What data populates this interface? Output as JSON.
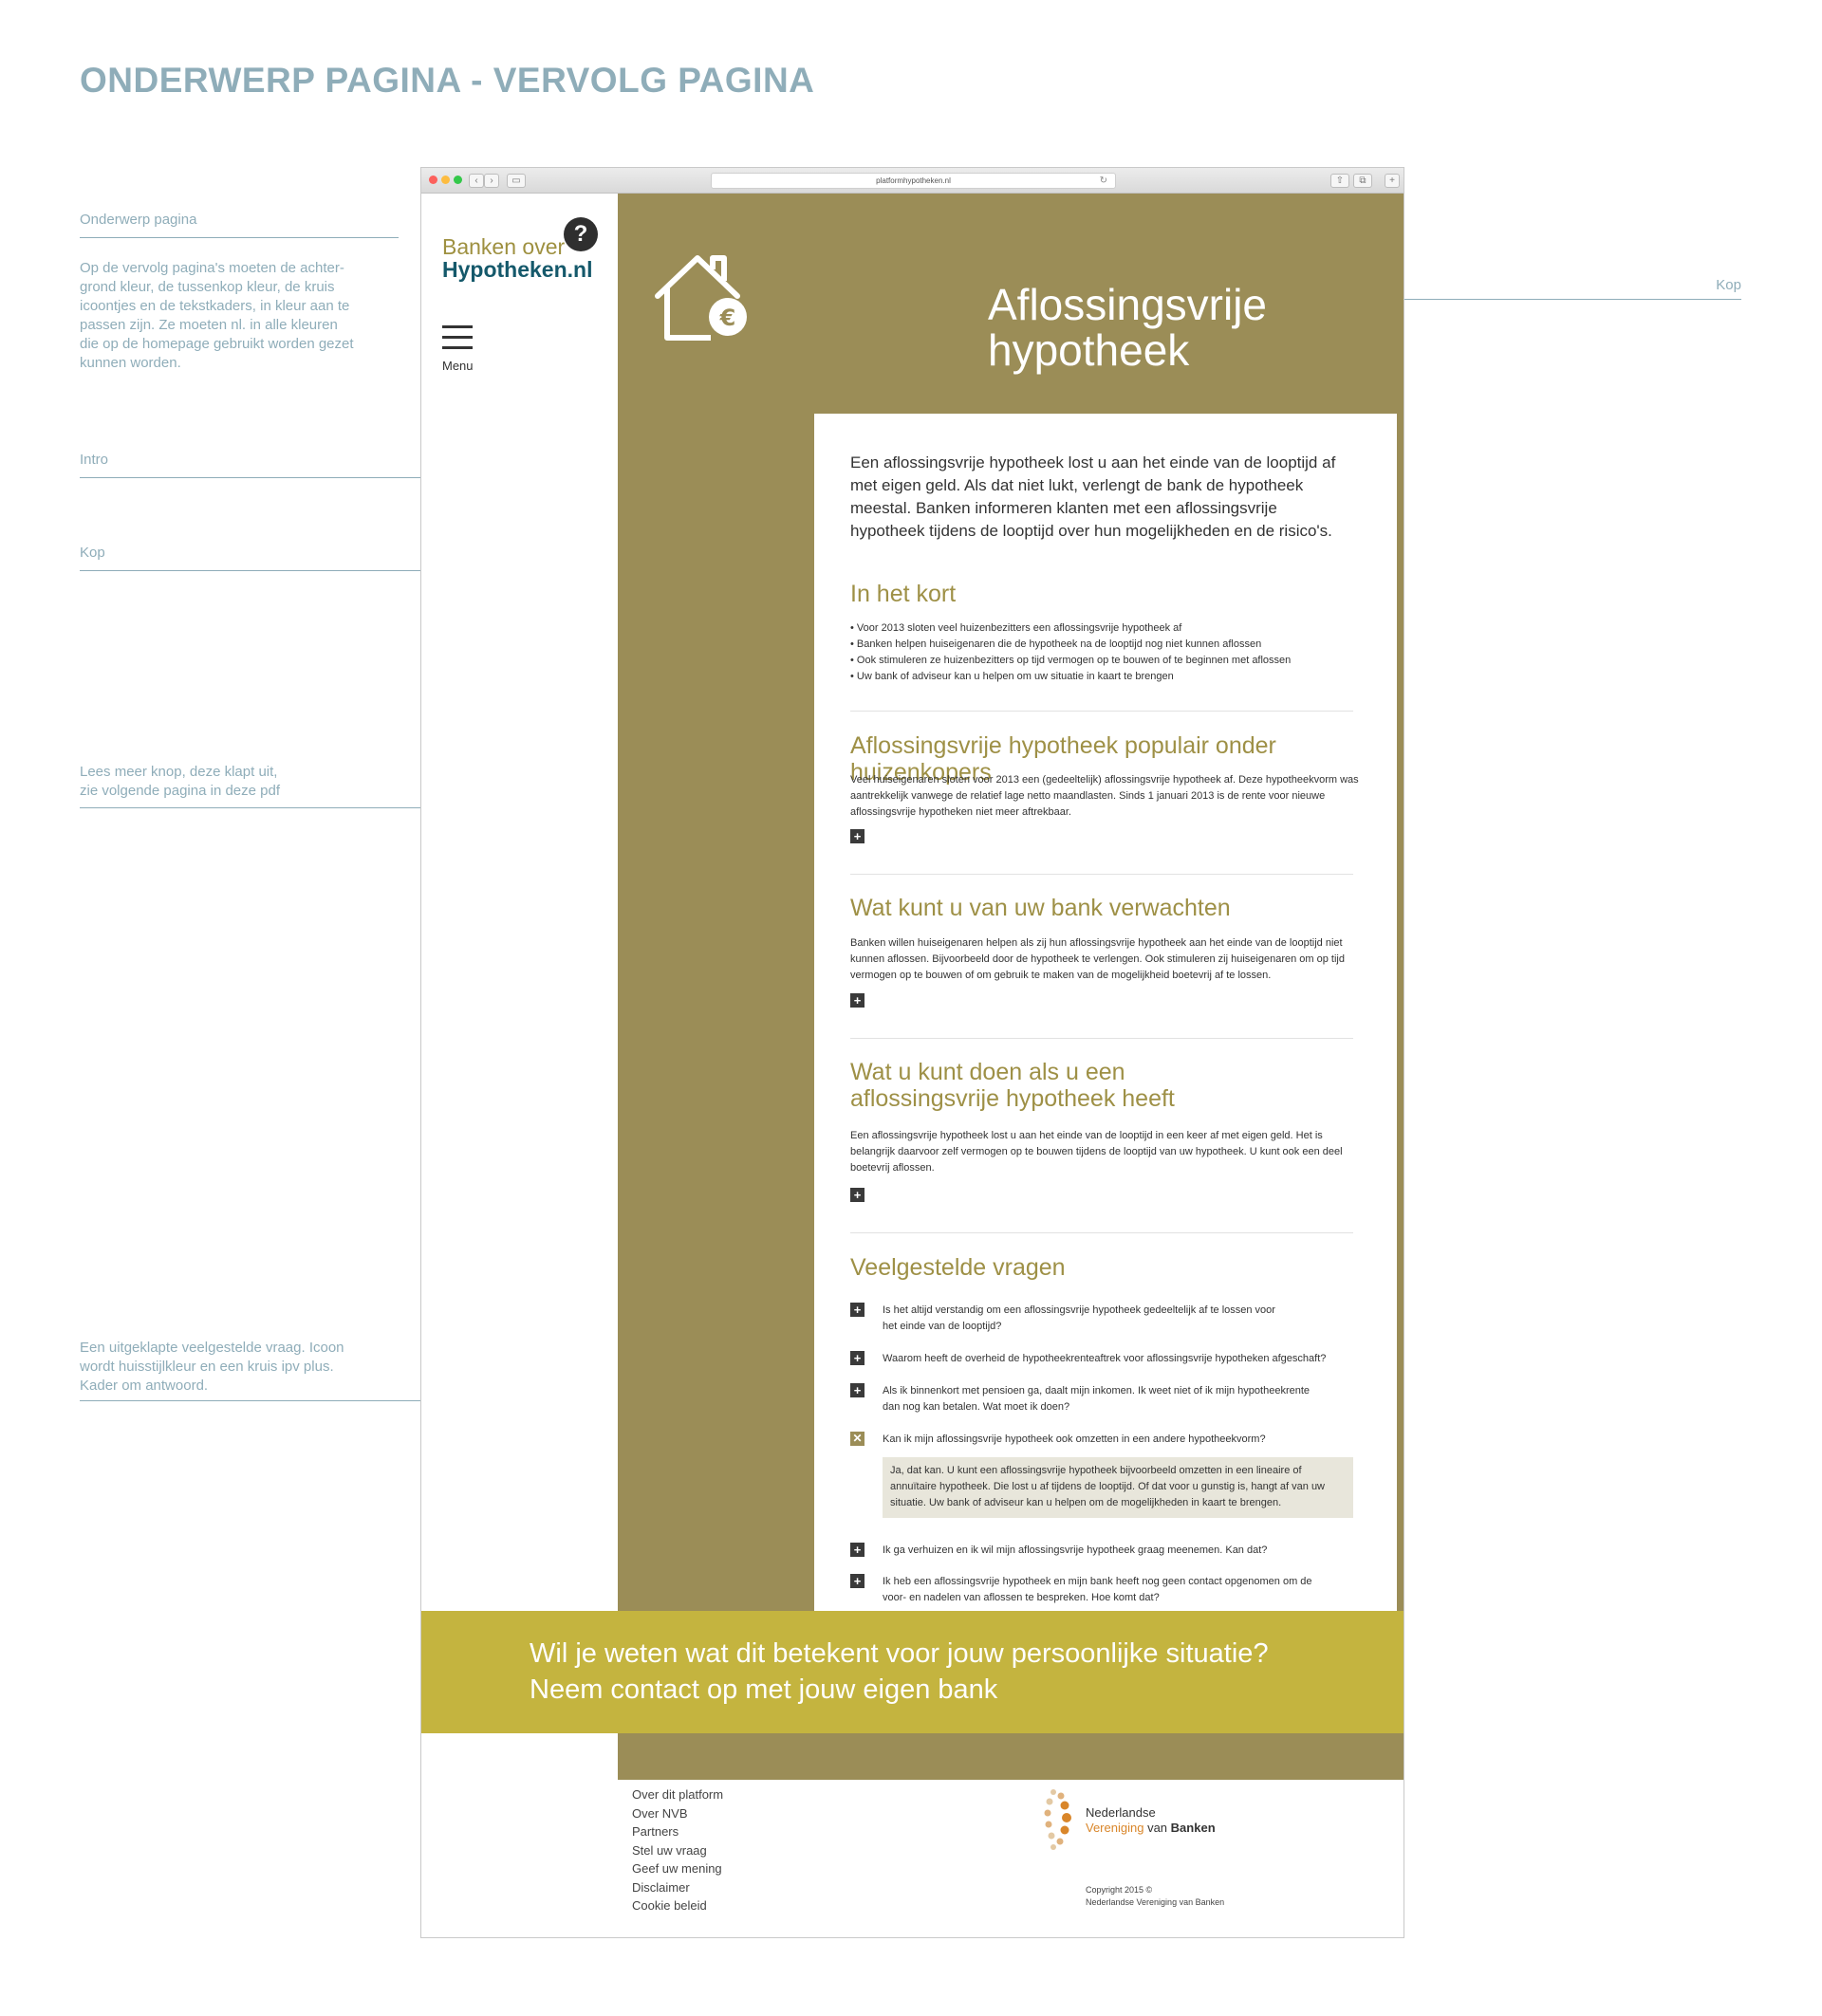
{
  "page_heading": "ONDERWERP PAGINA - VERVOLG PAGINA",
  "annotations": {
    "onderwerp_title": "Onderwerp pagina",
    "onderwerp_body": "Op de vervolg pagina's moeten de achter-grond kleur, de tussenkop kleur, de kruis icoontjes en de tekstkaders, in kleur aan te passen zijn. Ze moeten nl. in alle kleuren die op de homepage gebruikt worden gezet kunnen worden.",
    "intro": "Intro",
    "kop_left": "Kop",
    "kop_right": "Kop",
    "lees_meer": "Lees meer knop, deze klapt uit, zie volgende pagina in deze pdf",
    "faq_note": "Een uitgeklapte veelgestelde vraag. Icoon wordt huisstijlkleur en een kruis ipv plus. Kader om antwoord."
  },
  "browser": {
    "url": "platformhypotheken.nl"
  },
  "logo": {
    "line1": "Banken over",
    "line2": "Hypotheken.nl",
    "bubble": "?"
  },
  "menu_label": "Menu",
  "hero": {
    "title_line1": "Aflossingsvrije",
    "title_line2": "hypotheek"
  },
  "intro_text": "Een aflossingsvrije hypotheek lost u aan het einde van de looptijd af met eigen geld. Als dat niet lukt, verlengt de bank de hypotheek meestal. Banken informeren klanten met een aflossingsvrije hypotheek tijdens de looptijd over hun mogelijkheden en de risico's.",
  "kort": {
    "heading": "In het kort",
    "bullets": [
      "• Voor 2013 sloten veel huizenbezitters een aflossingsvrije hypotheek af",
      "• Banken helpen huiseigenaren die de hypotheek na de looptijd nog niet kunnen aflossen",
      "• Ook stimuleren ze huizenbezitters op tijd vermogen op te bouwen of te beginnen met aflossen",
      "• Uw bank of adviseur kan u helpen om uw situatie in kaart te brengen"
    ]
  },
  "sections": [
    {
      "heading": "Aflossingsvrije hypotheek populair onder huizenkopers",
      "body": "Veel huiseigenaren sloten voor 2013 een (gedeeltelijk) aflossingsvrije hypotheek af. Deze hypotheekvorm was aantrekkelijk vanwege de relatief lage netto maandlasten. Sinds 1 januari 2013 is de rente voor nieuwe aflossingsvrije hypotheken niet meer aftrekbaar."
    },
    {
      "heading": "Wat kunt u van uw bank verwachten",
      "body": "Banken willen huiseigenaren helpen als zij hun aflossingsvrije hypotheek aan het einde van de looptijd niet kunnen aflossen. Bijvoorbeeld door de hypotheek te verlengen. Ook stimuleren zij huiseigenaren om op tijd vermogen op te bouwen of om gebruik te maken van de mogelijkheid boetevrij af te lossen."
    },
    {
      "heading": "Wat u kunt doen als u een aflossingsvrije hypotheek heeft",
      "body": "Een aflossingsvrije hypotheek lost u aan het einde van de looptijd in een keer af met eigen geld. Het is belangrijk daarvoor zelf vermogen op te bouwen tijdens de looptijd van uw hypotheek. U kunt ook een deel boetevrij aflossen."
    }
  ],
  "faq": {
    "heading": "Veelgestelde vragen",
    "questions": [
      "Is het altijd verstandig om een aflossingsvrije hypotheek gedeeltelijk af te lossen voor het einde van de looptijd?",
      "Waarom heeft de overheid de hypotheekrenteaftrek voor aflossingsvrije hypotheken afgeschaft?",
      "Als ik binnenkort met pensioen ga, daalt mijn inkomen. Ik weet niet of ik mijn hypotheekrente dan nog kan betalen. Wat moet ik doen?",
      "Kan ik mijn aflossingsvrije hypotheek ook omzetten in een andere hypotheekvorm?",
      "Ik ga verhuizen en ik wil mijn aflossingsvrije hypotheek graag meenemen. Kan dat?",
      "Ik heb een aflossingsvrije hypotheek en mijn bank heeft nog geen contact opgenomen om de voor- en nadelen van aflossen te bespreken. Hoe komt dat?"
    ],
    "answer": "Ja, dat kan. U kunt een aflossingsvrije hypotheek bijvoorbeeld omzetten in een lineaire of annuïtaire hypotheek. Die lost u af tijdens de looptijd. Of dat voor u gunstig is, hangt af van uw situatie. Uw bank of adviseur kan u helpen om de mogelijkheden in kaart te brengen."
  },
  "cta": {
    "line1": "Wil je weten wat dit betekent voor jouw persoonlijke situatie?",
    "line2": "Neem contact op met jouw eigen bank"
  },
  "footer": {
    "links": [
      "Over dit platform",
      "Over NVB",
      "Partners",
      "Stel uw vraag",
      "Geef uw mening",
      "Disclaimer",
      "Cookie beleid"
    ],
    "nvb_line1": "Nederlandse",
    "nvb_line2a": "Vereniging",
    "nvb_line2b": "van",
    "nvb_line2c": "Banken",
    "copyright1": "Copyright 2015 ©",
    "copyright2": "Nederlandse Vereniging van Banken"
  },
  "colors": {
    "accent": "#9b8d57",
    "cta": "#c4b43f",
    "annotation": "#8fadb9",
    "logo_blue": "#15596b"
  }
}
